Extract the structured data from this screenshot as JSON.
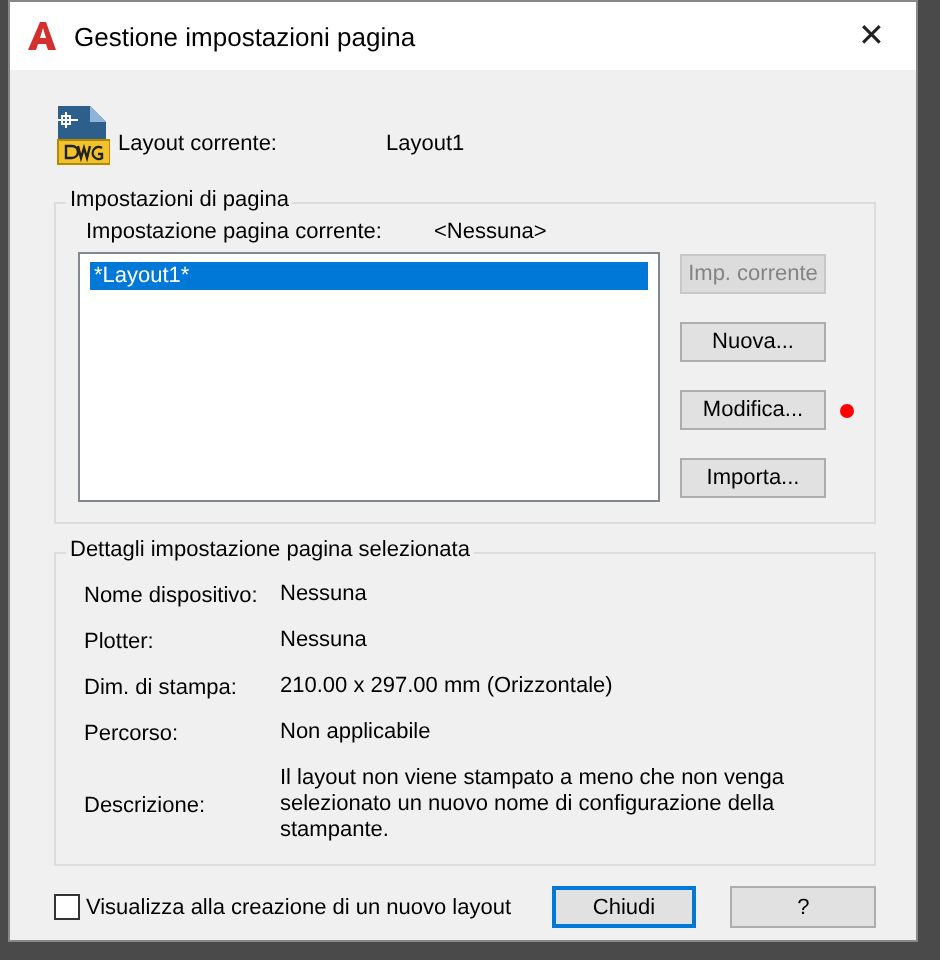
{
  "window": {
    "title": "Gestione impostazioni pagina",
    "close": "✕"
  },
  "current_layout": {
    "label": "Layout corrente:",
    "value": "Layout1"
  },
  "page_setups": {
    "title": "Impostazioni di pagina",
    "current_label": "Impostazione pagina corrente:",
    "current_value": "<Nessuna>",
    "items": [
      {
        "label": "*Layout1*",
        "selected": true
      }
    ],
    "buttons": [
      {
        "label": "Imp. corrente",
        "disabled": true
      },
      {
        "label": "Nuova...",
        "disabled": false
      },
      {
        "label": "Modifica...",
        "disabled": false,
        "color": "#ff0000"
      },
      {
        "label": "Importa...",
        "disabled": false
      }
    ]
  },
  "details": {
    "title": "Dettagli impostazione pagina selezionata",
    "rows": [
      {
        "label": "Nome dispositivo:",
        "value": "Nessuna"
      },
      {
        "label": "Plotter:",
        "value": "Nessuna"
      },
      {
        "label": "Dim. di stampa:",
        "value": "210.00 x 297.00 mm (Orizzontale)"
      },
      {
        "label": "Percorso:",
        "value": "Non applicabile"
      },
      {
        "label": "Descrizione:",
        "value": "Il layout non viene stampato a meno che non venga selezionato un nuovo nome di configurazione della stampante."
      }
    ]
  },
  "show_on_create": {
    "label": "Visualizza alla creazione di un nuovo layout",
    "checked": false
  },
  "footer_buttons": [
    {
      "label": "Chiudi",
      "default": true
    },
    {
      "label": "?",
      "default": false
    }
  ]
}
